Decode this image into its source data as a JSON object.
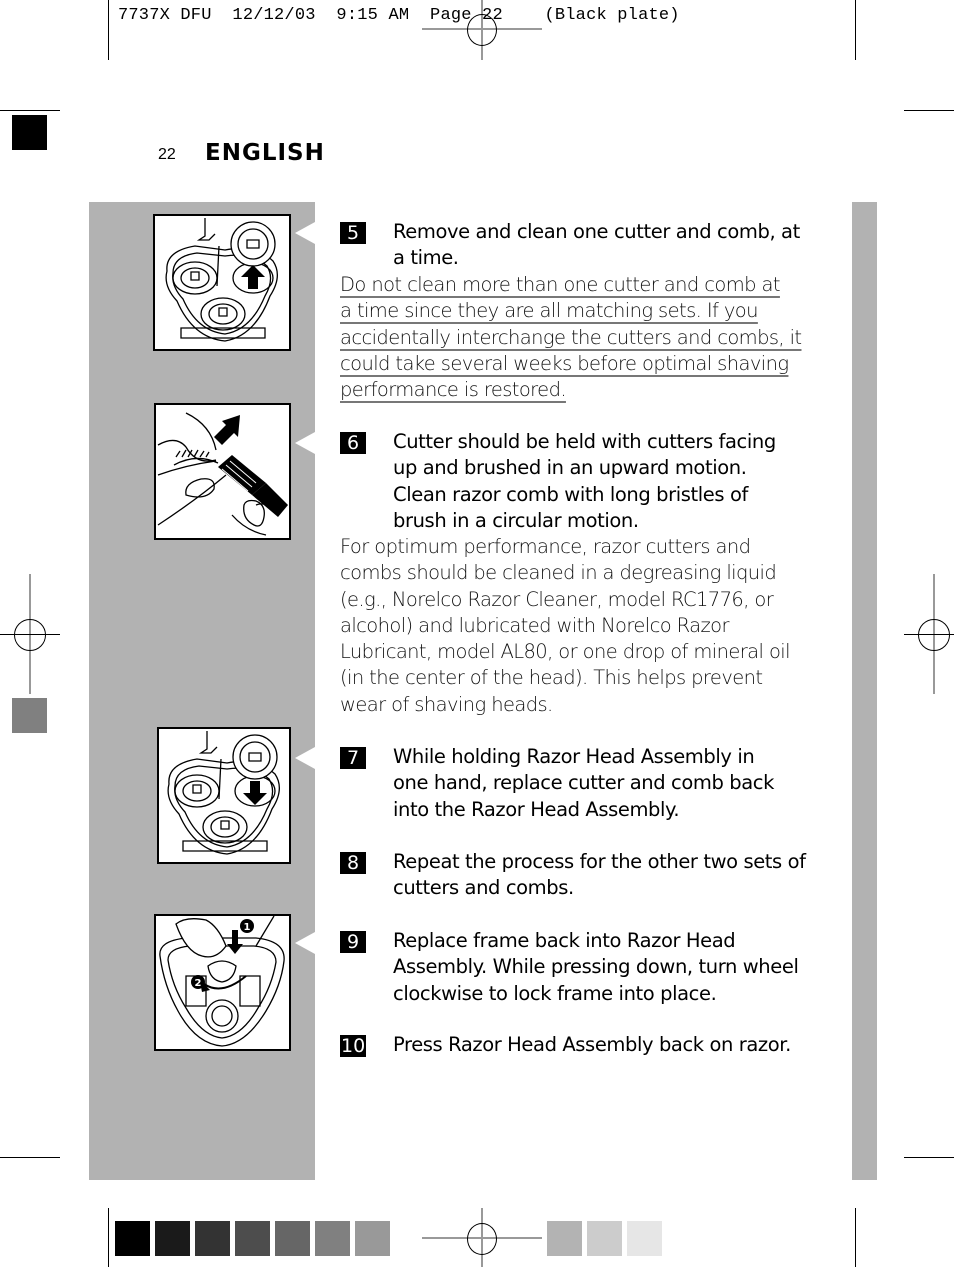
{
  "slug": {
    "text": "7737X DFU  12/12/03  9:15 AM  Page 22    (Black plate)"
  },
  "header": {
    "page_number": "22",
    "language": "ENGLISH"
  },
  "figures": [
    {
      "name": "figure-remove-cutter",
      "description": "razor-head-arrow-up-icon"
    },
    {
      "name": "figure-brush-cutter",
      "description": "brush-cleaning-icon"
    },
    {
      "name": "figure-replace-cutter",
      "description": "razor-head-arrow-down-icon"
    },
    {
      "name": "figure-lock-frame",
      "description": "turn-wheel-icon",
      "callouts": [
        "1",
        "2"
      ]
    }
  ],
  "steps": [
    {
      "number": "5",
      "text": "Remove and clean one cutter and comb, at a time.",
      "note_lines": [
        "Do not clean more than one cutter and comb at",
        "a time since they are all matching sets. If you",
        "accidentally interchange the cutters and combs, it",
        "could take several weeks before optimal shaving",
        "performance is restored."
      ]
    },
    {
      "number": "6",
      "text": "Cutter should be held with cutters facing up and brushed in an upward motion. Clean razor comb with long bristles of brush in a circular motion.",
      "note": "For optimum performance, razor cutters and combs should be cleaned in a degreasing liquid (e.g., Norelco Razor Cleaner, model RC1776, or alcohol) and lubricated with Norelco Razor Lubricant, model AL80, or one drop of mineral oil (in the center of the head). This helps prevent wear of shaving heads."
    },
    {
      "number": "7",
      "text": "While holding Razor Head Assembly in one hand, replace cutter and comb back into the Razor Head Assembly."
    },
    {
      "number": "8",
      "text": "Repeat the process for the other two sets of cutters and combs."
    },
    {
      "number": "9",
      "text": "Replace frame back into Razor Head Assembly.  While pressing down, turn wheel clockwise to lock frame into place."
    },
    {
      "number": "10",
      "text": "Press Razor Head Assembly back on razor."
    }
  ],
  "colors": {
    "panel_grey": "#b2b2b2",
    "swatches": [
      "#000000",
      "#1a1a1a",
      "#333333",
      "#4d4d4d",
      "#666666",
      "#808080",
      "#999999",
      "#b3b3b3",
      "#cccccc",
      "#e6e6e6"
    ]
  }
}
